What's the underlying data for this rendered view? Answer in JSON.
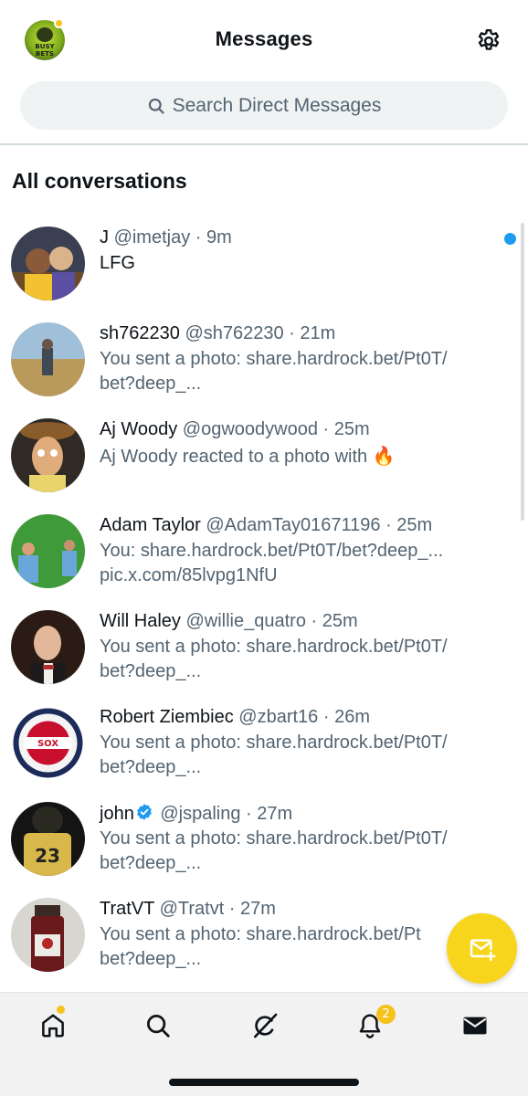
{
  "header": {
    "title": "Messages",
    "avatar_text": "BUSY BETS"
  },
  "search": {
    "placeholder": "Search Direct Messages"
  },
  "section_title": "All conversations",
  "conversations": [
    {
      "name": "J",
      "meta": "@imetjay · 9m",
      "line2": "LFG",
      "line3": "",
      "unread": true
    },
    {
      "name": "sh762230",
      "meta": "@sh762230 · 21m",
      "line2": "You sent a photo: share.hardrock.bet/Pt0T/",
      "line3": "bet?deep_..."
    },
    {
      "name": "Aj Woody",
      "meta": "@ogwoodywood · 25m",
      "line2": "Aj Woody reacted to a photo with 🔥",
      "line3": ""
    },
    {
      "name": "Adam Taylor",
      "meta": "@AdamTay01671196 · 25m",
      "line2": "You: share.hardrock.bet/Pt0T/bet?deep_...",
      "line3": "pic.x.com/85lvpg1NfU"
    },
    {
      "name": "Will Haley",
      "meta": "@willie_quatro · 25m",
      "line2": "You sent a photo: share.hardrock.bet/Pt0T/",
      "line3": "bet?deep_..."
    },
    {
      "name": "Robert Ziembiec",
      "meta": "@zbart16 · 26m",
      "line2": "You sent a photo: share.hardrock.bet/Pt0T/",
      "line3": "bet?deep_..."
    },
    {
      "name": "john",
      "meta": "@jspaling · 27m",
      "line2": "You sent a photo: share.hardrock.bet/Pt0T/",
      "line3": "bet?deep_...",
      "verified": true
    },
    {
      "name": "TratVT",
      "meta": "@Tratvt · 27m",
      "line2": "You sent a photo: share.hardrock.bet/Pt",
      "line3": "bet?deep_..."
    }
  ],
  "tabbar": {
    "notifications_badge": "2"
  },
  "colors": {
    "accent_blue": "#1d9bf0",
    "brand_yellow": "#f7d51c",
    "text_secondary": "#536471"
  },
  "icons": [
    "gear-icon",
    "search-icon",
    "home-icon",
    "grok-icon",
    "bell-icon",
    "mail-icon",
    "compose-message-icon",
    "verified-icon"
  ]
}
